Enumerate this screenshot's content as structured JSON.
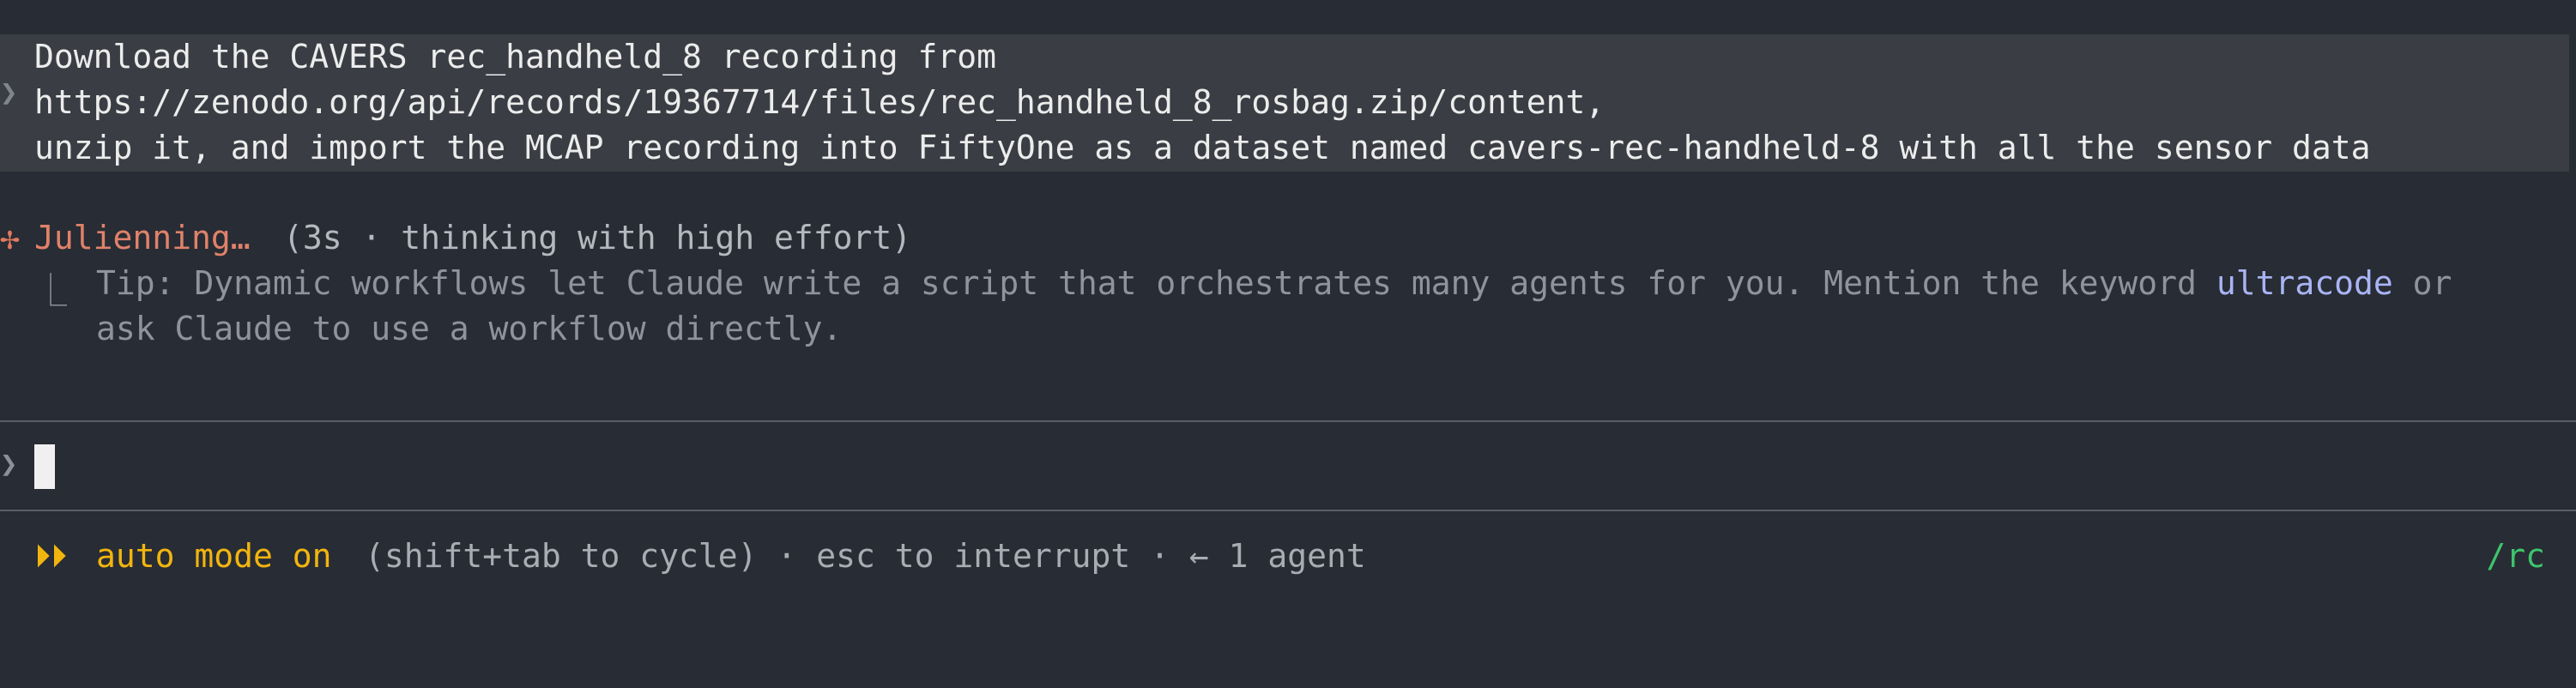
{
  "prompt": {
    "chevron_icon": "❯",
    "lines": [
      "Download the CAVERS rec_handheld_8 recording from",
      "https://zenodo.org/api/records/19367714/files/rec_handheld_8_rosbag.zip/content,",
      "unzip it, and import the MCAP recording into FiftyOne as a dataset named cavers-rec-handheld-8 with all the sensor data"
    ]
  },
  "status": {
    "spinner_icon": "✢",
    "word": "Julienning…",
    "meta": "(3s · thinking with high effort)"
  },
  "tip": {
    "branch_icon": "⎿",
    "line1_before": "Tip: Dynamic workflows let Claude write a script that orchestrates many agents for you. Mention the keyword ",
    "keyword": "ultracode",
    "line1_after": " or",
    "line2": "ask Claude to use a workflow directly."
  },
  "input": {
    "chevron_icon": "❯",
    "value": ""
  },
  "footer": {
    "arrows_icon": "⏵⏵",
    "mode_label": "auto mode on",
    "hint": "(shift+tab to cycle) · esc to interrupt · ← 1 agent",
    "rc": "/rc"
  }
}
